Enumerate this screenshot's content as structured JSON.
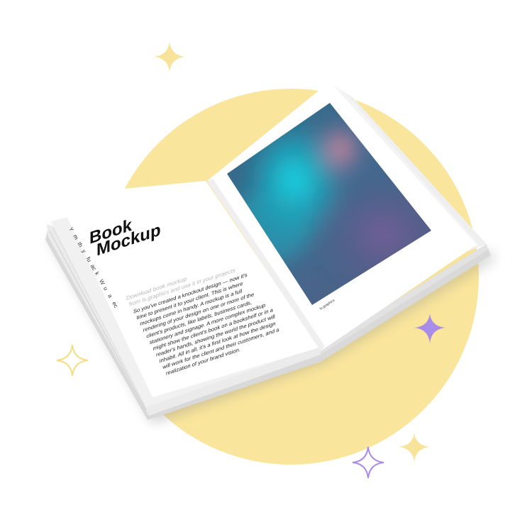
{
  "book": {
    "title_line1": "Book",
    "title_line2": "Mockup",
    "subtitle_line1": "Download book mockup",
    "subtitle_line2": "from ls.graphics and use it in your projects",
    "body_lines": [
      "So you've created a knockout design — now it's",
      "time to present it to your client. This is where",
      "mockups come in handy. A mockup is a full",
      "rendering of your design on one or more of the",
      "client's products, like labels, business cards,",
      "stationery and signage. A more complex mockup",
      "might show the client's book on a bookshelf or in a",
      "reader's hands, showing the world the product will",
      "inhabit. All in all, it's a first look at how the design",
      "will work for the client and their customers, and a",
      "realization of your brand vision."
    ],
    "edge_chars": [
      "Y",
      "m",
      "th",
      "y",
      "fu",
      "ac",
      "k",
      "W",
      "u",
      "a",
      "ec"
    ],
    "photo_caption": "ls.graphics"
  },
  "colors": {
    "background": "#ffffff",
    "circle": "#f9e59b",
    "sparkle_yellow": "#f7e39a",
    "sparkle_purple": "#a98be8"
  }
}
